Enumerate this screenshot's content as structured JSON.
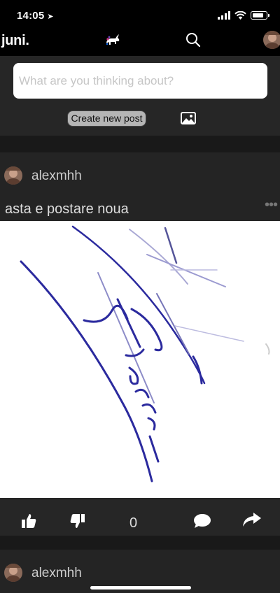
{
  "status_bar": {
    "time": "14:05",
    "location_glyph": "➤"
  },
  "header": {
    "brand": "juni.",
    "logo_icon": "unicorn-icon",
    "search_icon": "search-icon"
  },
  "composer": {
    "placeholder": "What are you thinking about?",
    "create_button": "Create new post",
    "image_icon": "image-icon"
  },
  "feed": {
    "posts": [
      {
        "author": "alexmhh",
        "text": "asta e postare noua",
        "likes": "0",
        "more_glyph": "•••"
      },
      {
        "author": "alexmhh"
      }
    ]
  },
  "colors": {
    "background": "#1e1e1e",
    "card": "#262626",
    "header": "#000000",
    "button": "#b5b5b5",
    "ink": "#2b2a9e"
  }
}
